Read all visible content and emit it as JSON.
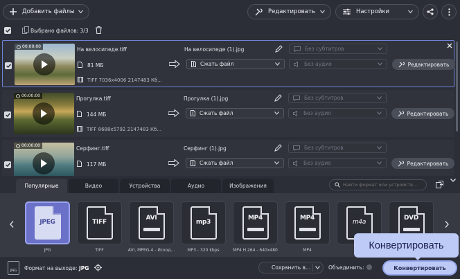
{
  "toolbar": {
    "add_files": "Добавить файлы",
    "edit": "Редактировать",
    "settings": "Настройки"
  },
  "selection": {
    "label": "Выбрано файлов: 3/3"
  },
  "files": [
    {
      "time": "00:00:00",
      "name": "На велосипеде.tiff",
      "size": "81 МБ",
      "info": "TIFF 7036x4006 2147483 Кб...",
      "output": "На велосипеде (1).jpg",
      "action": "Сжать файл",
      "subtitles": "Без субтитров",
      "audio": "Без аудио",
      "edit": "Редактировать"
    },
    {
      "time": "00:00:00",
      "name": "Прогулка.tiff",
      "size": "144 МБ",
      "info": "TIFF 8688x5792 2147483 Кб...",
      "output": "Прогулка (1).jpg",
      "action": "Сжать файл",
      "subtitles": "Без субтитров",
      "audio": "Без аудио",
      "edit": "Редактировать"
    },
    {
      "time": "00:00:00",
      "name": "Серфинг.tiff",
      "size": "117 МБ",
      "info": "",
      "output": "Серфинг (1).jpg",
      "action": "Сжать файл",
      "subtitles": "Без субтитров",
      "audio": "Без аудио",
      "edit": "Редактировать"
    }
  ],
  "tabs": [
    "Популярные",
    "Видео",
    "Устройства",
    "Аудио",
    "Изображения"
  ],
  "search": {
    "placeholder": "Найти формат или устройств..."
  },
  "formats": [
    {
      "icon": "JPEG",
      "label": "JPG"
    },
    {
      "icon": "TIFF",
      "label": "TIFF"
    },
    {
      "icon": "AVI",
      "label": "AVI, MPEG-4 - Исход..."
    },
    {
      "icon": "mp3",
      "label": "MP3 - 320 kbps"
    },
    {
      "icon": "MP4",
      "label": "MP4 H.264 - 640x480"
    },
    {
      "icon": "MP4",
      "label": "MP4"
    },
    {
      "icon": "m4a",
      "label": ""
    },
    {
      "icon": "DVD",
      "label": ""
    }
  ],
  "bottom": {
    "output_format_label": "Формат на выходе:",
    "output_format": "JPG",
    "save": "Сохранить в...",
    "merge": "Объединить:",
    "convert": "Конвертировать",
    "tooltip": "Конвертировать"
  },
  "colors": {
    "accent": "#6b71c8",
    "convert_bg": "#bcc8f6"
  }
}
